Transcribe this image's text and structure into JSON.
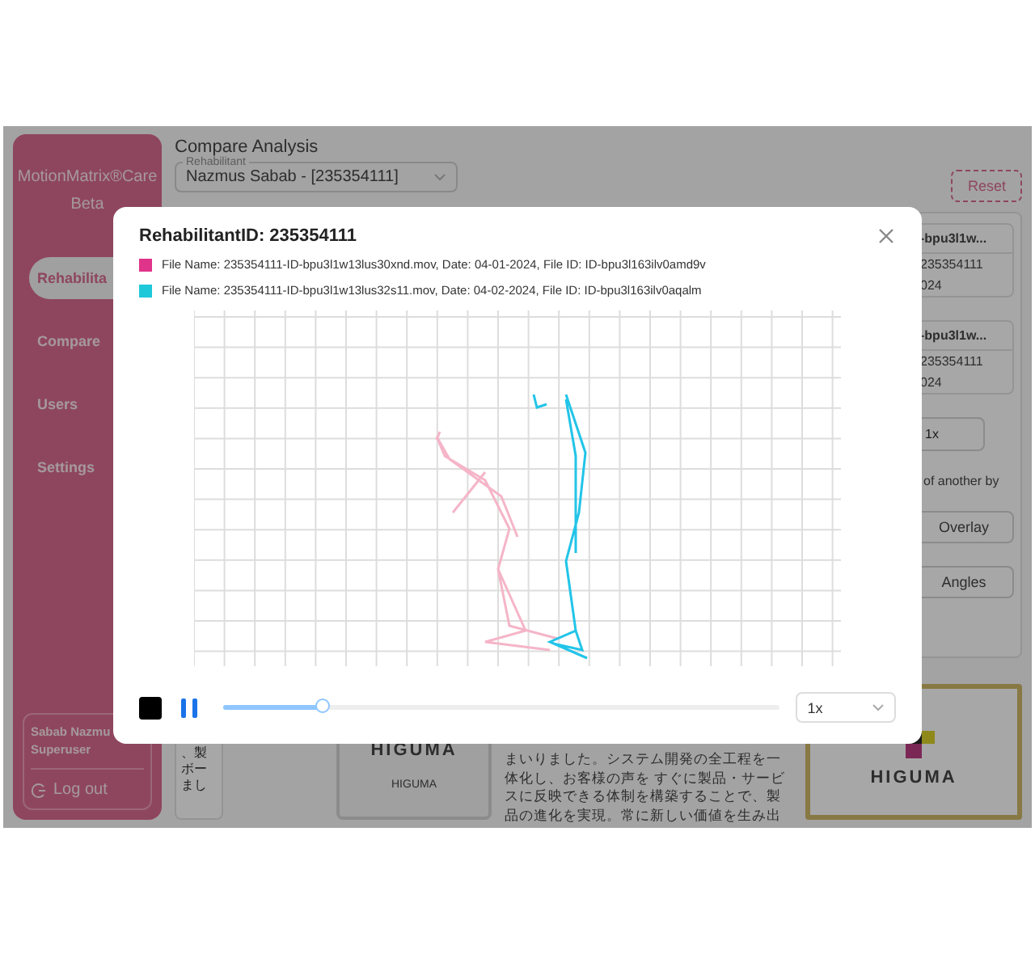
{
  "sidebar": {
    "brand": "MotionMatrix®Care",
    "edition": "Beta",
    "items": [
      {
        "label": "Rehabilita",
        "selected": true
      },
      {
        "label": "Compare",
        "selected": false
      },
      {
        "label": "Users",
        "selected": false
      },
      {
        "label": "Settings",
        "selected": false
      }
    ],
    "user": {
      "name": "Sabab Nazmu",
      "role": "Superuser"
    },
    "logout": "Log out"
  },
  "page": {
    "title": "Compare Analysis",
    "rehabilitant": {
      "label": "Rehabilitant",
      "value": "Nazmus Sabab - [235354111]"
    },
    "reset": "Reset",
    "file_cards": [
      {
        "title": "-bpu3l1w...",
        "lines": [
          "235354111",
          "024"
        ]
      },
      {
        "title": "-bpu3l1w...",
        "lines": [
          "235354111",
          "024"
        ]
      }
    ],
    "speed": "1x",
    "hint": "of another by",
    "buttons": [
      "Overlay",
      "Angles"
    ],
    "snippet": [
      "、製",
      "ボー",
      "まし"
    ],
    "logo_card": {
      "brand": "HIGUMA",
      "footer": "HIGUMA"
    },
    "paragraph": [
      "まいりました。システム開発の全工程を一",
      "体化し、お客様の声を すぐに製品・サービ",
      "スに反映できる体制を構築することで、製",
      "品の進化を実現。常に新しい価値を生み出"
    ],
    "gold_card": {
      "brand": "HIGUMA"
    }
  },
  "modal": {
    "title": "RehabilitantID: 235354111",
    "legend": [
      {
        "text": "File Name: 235354111-ID-bpu3l1w13lus30xnd.mov, Date: 04-01-2024, File ID: ID-bpu3l163ilv0amd9v",
        "color": "#e0338a"
      },
      {
        "text": "File Name: 235354111-ID-bpu3l1w13lus32s11.mov, Date: 04-02-2024, File ID: ID-bpu3l163ilv0aqalm",
        "color": "#1ec8d8"
      }
    ],
    "player": {
      "playing": true,
      "level": 0.18,
      "speed": "1x"
    }
  }
}
